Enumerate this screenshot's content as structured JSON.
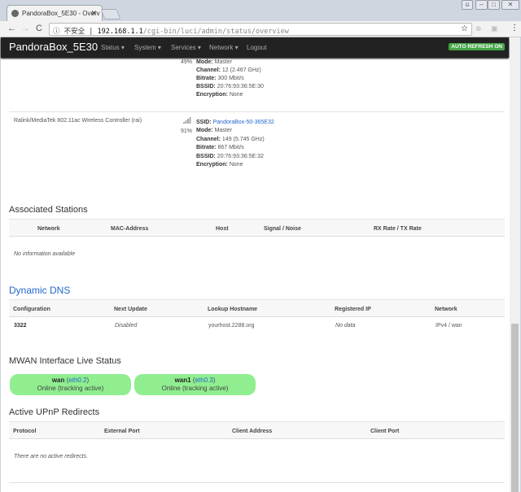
{
  "browser": {
    "tab_title": "PandoraBox_5E30 - Overv",
    "security": "不安全",
    "url_host": "192.168.1.1",
    "url_path": "/cgi-bin/luci/admin/status/overview"
  },
  "nav": {
    "brand": "PandoraBox_5E30",
    "menus": [
      "Status ▾",
      "System ▾",
      "Services ▾",
      "Network ▾",
      "Logout"
    ],
    "auto_refresh": "AUTO REFRESH ON"
  },
  "wireless": [
    {
      "device": "",
      "signal": "49%",
      "mode": "Master",
      "channel": "12 (2.467 GHz)",
      "bitrate": "300 Mbit/s",
      "bssid": "20:76:93:36:5E:30",
      "encryption": "None"
    },
    {
      "device": "Ralink/MediaTek 802.11ac Wireless Controller (rai)",
      "signal": "91%",
      "ssid": "PandoraBox-50-365E32",
      "mode": "Master",
      "channel": "149 (5.745 GHz)",
      "bitrate": "867 Mbit/s",
      "bssid": "20:76:93:36:5E:32",
      "encryption": "None"
    }
  ],
  "labels": {
    "ssid": "SSID:",
    "mode": "Mode:",
    "channel": "Channel:",
    "bitrate": "Bitrate:",
    "bssid": "BSSID:",
    "encryption": "Encryption:"
  },
  "assoc": {
    "title": "Associated Stations",
    "columns": [
      "Network",
      "MAC-Address",
      "Host",
      "Signal / Noise",
      "RX Rate / TX Rate"
    ],
    "empty": "No information available"
  },
  "ddns": {
    "title": "Dynamic DNS",
    "columns": [
      "Configuration",
      "Next Update",
      "Lookup Hostname",
      "Registered IP",
      "Network"
    ],
    "row": [
      "3322",
      "Disabled",
      "yourhost.2288.org",
      "No data",
      "IPv4 / wan"
    ]
  },
  "mwan": {
    "title": "MWAN Interface Live Status",
    "interfaces": [
      {
        "name": "wan",
        "dev": "eth0.2",
        "status": "Online (tracking active)"
      },
      {
        "name": "wan1",
        "dev": "eth0.3",
        "status": "Online (tracking active)"
      }
    ]
  },
  "upnp": {
    "title": "Active UPnP Redirects",
    "columns": [
      "Protocol",
      "External Port",
      "Client Address",
      "Client Port"
    ],
    "empty": "There are no active redirects."
  },
  "colors": {
    "navbar": "#222222",
    "refresh_badge": "#46a546",
    "online_pill": "#90ee90",
    "link": "#2266cc"
  }
}
